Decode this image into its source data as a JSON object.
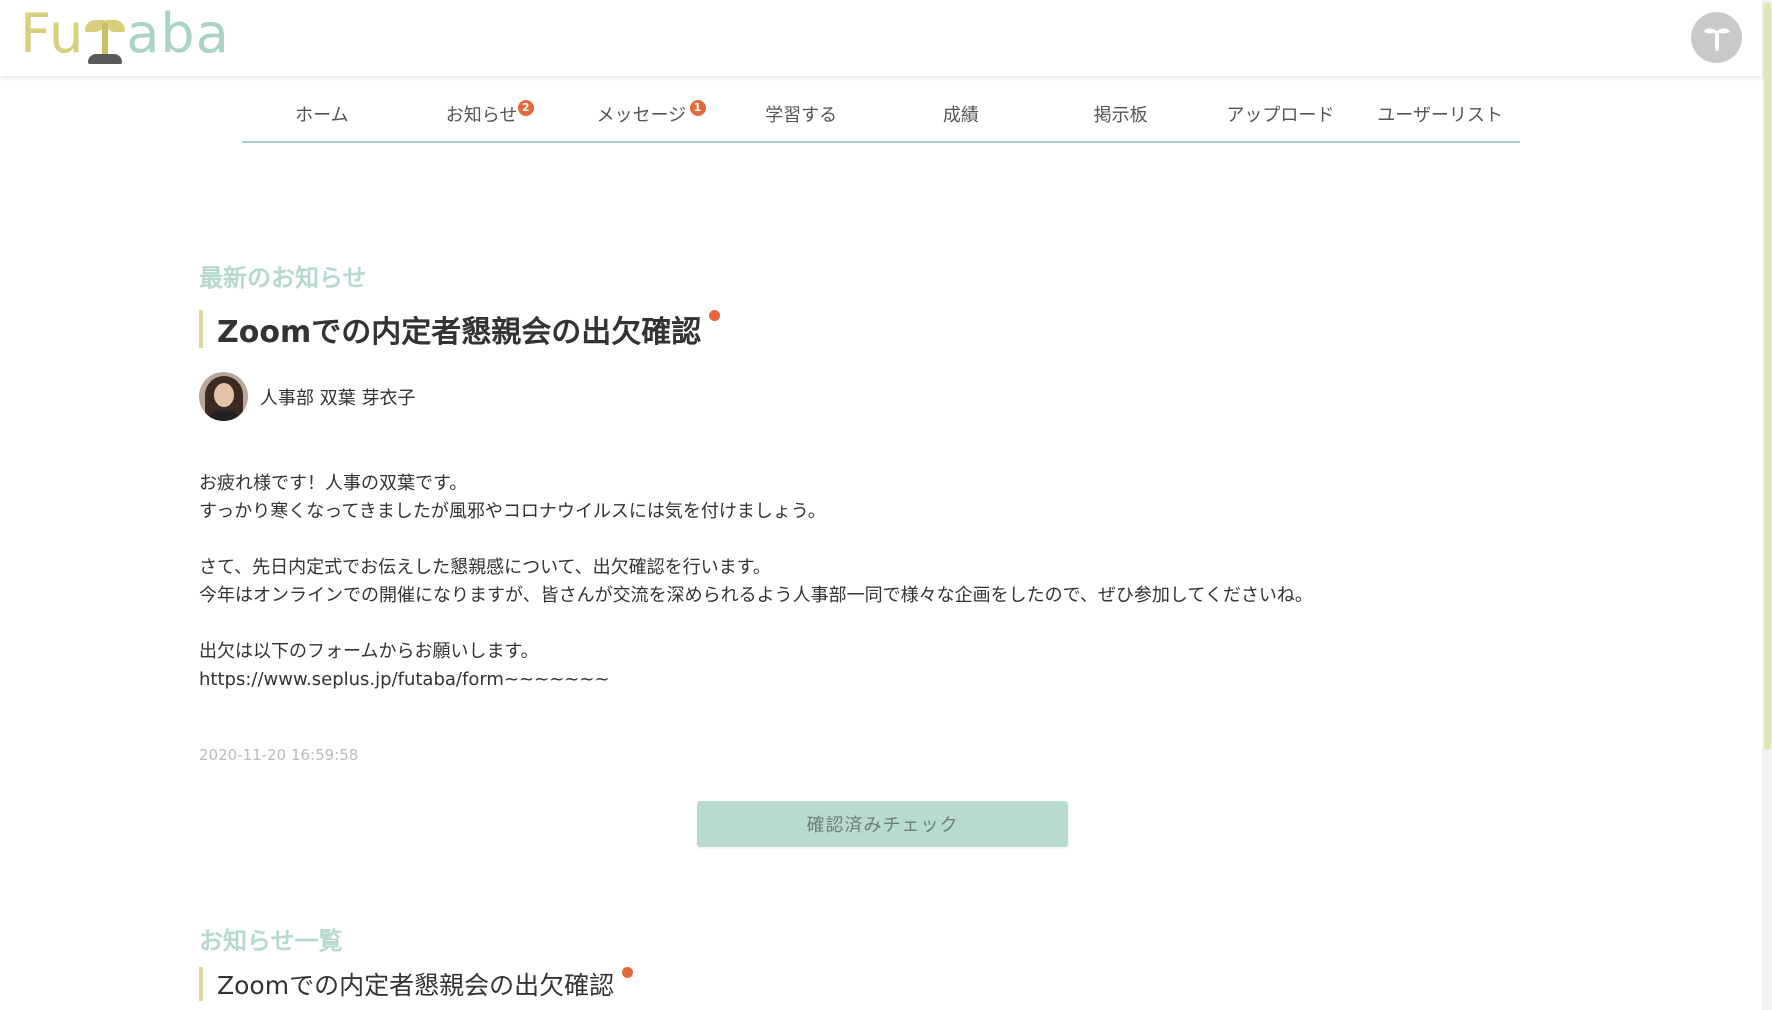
{
  "header": {
    "logo_parts": [
      "Fu",
      "aba"
    ],
    "user_icon": "sprout-user-icon"
  },
  "nav": {
    "items": [
      {
        "label": "ホーム",
        "badge": null
      },
      {
        "label": "お知らせ",
        "badge": "2"
      },
      {
        "label": "メッセージ",
        "badge": "1"
      },
      {
        "label": "学習する",
        "badge": null
      },
      {
        "label": "成績",
        "badge": null
      },
      {
        "label": "掲示板",
        "badge": null
      },
      {
        "label": "アップロード",
        "badge": null
      },
      {
        "label": "ユーザーリスト",
        "badge": null
      }
    ]
  },
  "latest": {
    "section_title": "最新のお知らせ",
    "title": "Zoomでの内定者懇親会の出欠確認",
    "author": "人事部 双葉 芽衣子",
    "body_lines": [
      "お疲れ様です！人事の双葉です。",
      "すっかり寒くなってきましたが風邪やコロナウイルスには気を付けましょう。",
      "",
      "さて、先日内定式でお伝えした懇親感について、出欠確認を行います。",
      "今年はオンラインでの開催になりますが、皆さんが交流を深められるよう人事部一同で様々な企画をしたので、ぜひ参加してくださいね。",
      "",
      "出欠は以下のフォームからお願いします。",
      "https://www.seplus.jp/futaba/form~~~~~~~"
    ],
    "timestamp": "2020-11-20 16:59:58",
    "confirm_label": "確認済みチェック"
  },
  "list": {
    "section_title": "お知らせ一覧",
    "items": [
      {
        "title": "Zoomでの内定者懇親会の出欠確認",
        "unread": true
      }
    ]
  },
  "colors": {
    "accent_green": "#a9d3c5",
    "logo_yellow": "#d8cf7d",
    "badge_orange": "#e5683a",
    "button_green": "#b7dbcd"
  }
}
